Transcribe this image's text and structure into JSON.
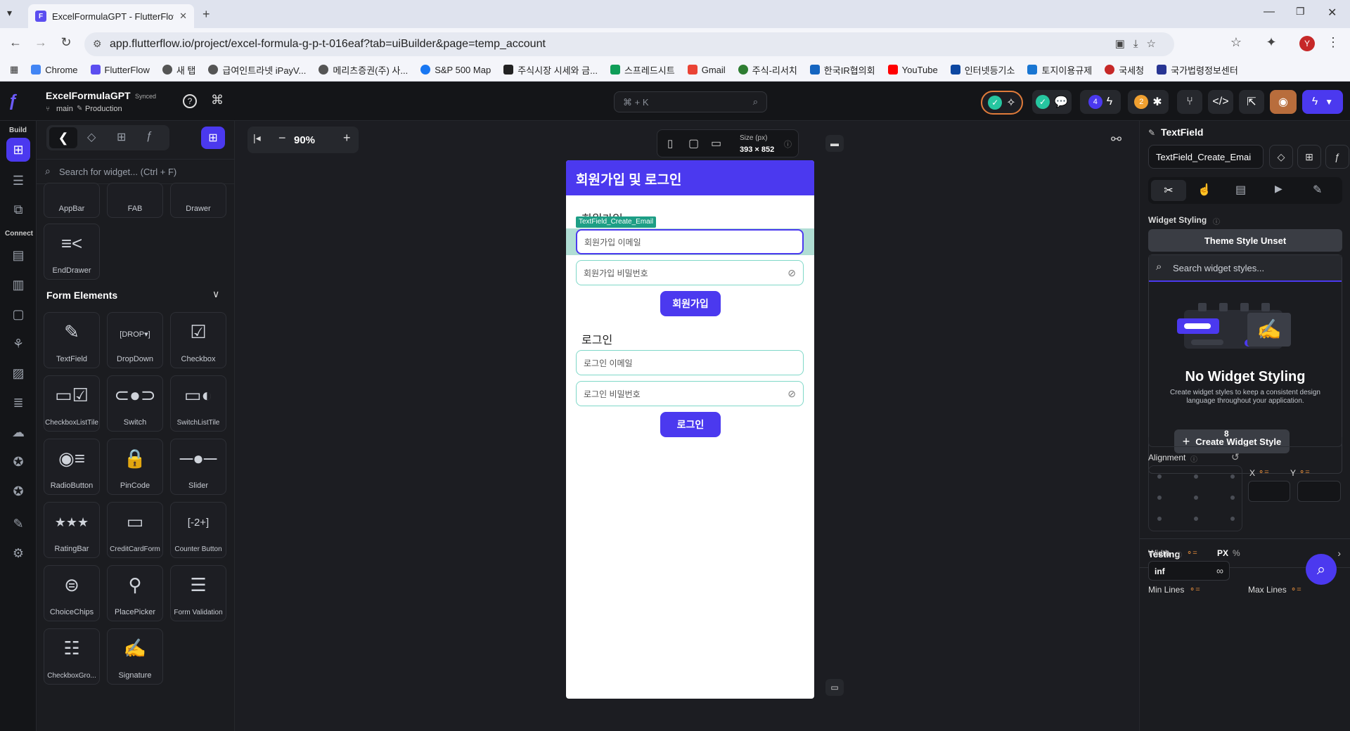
{
  "browser": {
    "tab_title": "ExcelFormulaGPT - FlutterFlow",
    "url": "app.flutterflow.io/project/excel-formula-g-p-t-016eaf?tab=uiBuilder&page=temp_account",
    "bookmarks": [
      "Chrome",
      "FlutterFlow",
      "새 탭",
      "급여인트라넷 iPayV...",
      "메리츠증권(주) 사...",
      "S&P 500 Map",
      "주식시장 시세와 금...",
      "스프레드시트",
      "Gmail",
      "주식-리서치",
      "한국IR협의회",
      "YouTube",
      "인터넷등기소",
      "토지이용규제",
      "국세청",
      "국가법령정보센터"
    ],
    "profile_initial": "Y"
  },
  "header": {
    "project_name": "ExcelFormulaGPT",
    "sync_status": "Synced",
    "branch": "main",
    "environment": "Production",
    "search_placeholder": "⌘ + K",
    "badge_count_1": "4",
    "badge_count_2": "2"
  },
  "rail": {
    "build_label": "Build",
    "connect_label": "Connect"
  },
  "widget_panel": {
    "search_placeholder": "Search for widget... (Ctrl + F)",
    "layout_items": [
      "AppBar",
      "FAB",
      "Drawer",
      "EndDrawer"
    ],
    "section_title": "Form Elements",
    "form_items": [
      "TextField",
      "DropDown",
      "Checkbox",
      "CheckboxListTile",
      "Switch",
      "SwitchListTile",
      "RadioButton",
      "PinCode",
      "Slider",
      "RatingBar",
      "CreditCardForm",
      "Counter Button",
      "ChoiceChips",
      "PlacePicker",
      "Form Validation",
      "CheckboxGro...",
      "Signature"
    ]
  },
  "canvas": {
    "zoom": "90%",
    "size_label": "Size (px)",
    "size_value": "393 × 852",
    "phone": {
      "appbar_title": "회원가입 및 로그인",
      "signup_heading": "회원가입",
      "selected_widget_tag": "TextField_Create_Email",
      "signup_email_placeholder": "회원가입 이메일",
      "signup_password_placeholder": "회원가입 비밀번호",
      "signup_button": "회원가입",
      "login_heading": "로그인",
      "login_email_placeholder": "로그인 이메일",
      "login_password_placeholder": "로그인 비밀번호",
      "login_button": "로그인"
    }
  },
  "properties": {
    "widget_type": "TextField",
    "widget_name": "TextField_Create_Emai",
    "widget_styling_label": "Widget Styling",
    "theme_style_button": "Theme Style Unset",
    "style_search_placeholder": "Search widget styles...",
    "empty_title": "No Widget Styling",
    "empty_desc": "Create widget styles to keep a consistent design language throughout your application.",
    "create_button": "Create Widget Style",
    "value_8": "8",
    "alignment_label": "Alignment",
    "x_label": "X",
    "y_label": "Y",
    "testing_label": "Testing",
    "width_label": "Width",
    "px_label": "PX",
    "pct_label": "%",
    "width_value": "inf",
    "inf_symbol": "∞",
    "min_lines_label": "Min Lines",
    "max_lines_label": "Max Lines"
  },
  "colors": {
    "accent": "#4b39ef",
    "field_border": "#7fd8c8",
    "selection": "#1d9e85"
  }
}
